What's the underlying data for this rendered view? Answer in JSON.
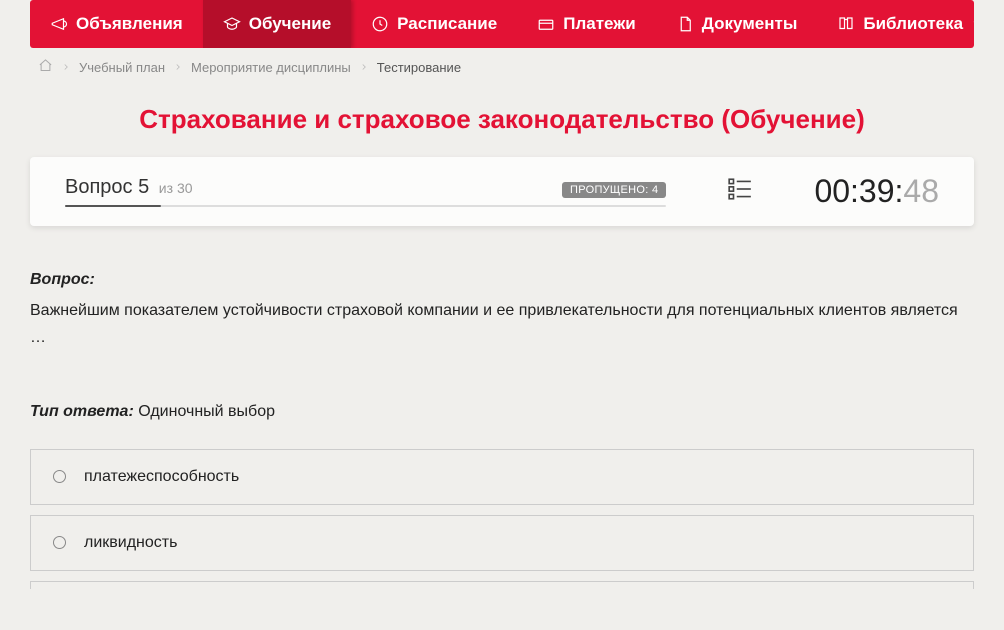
{
  "nav": [
    {
      "label": "Объявления",
      "icon": "megaphone"
    },
    {
      "label": "Обучение",
      "icon": "education",
      "active": true
    },
    {
      "label": "Расписание",
      "icon": "clock"
    },
    {
      "label": "Платежи",
      "icon": "payment"
    },
    {
      "label": "Документы",
      "icon": "document"
    },
    {
      "label": "Библиотека",
      "icon": "library",
      "hasChevron": true
    }
  ],
  "breadcrumb": {
    "items": [
      "Учебный план",
      "Мероприятие дисциплины",
      "Тестирование"
    ]
  },
  "title": "Страхование и страховое законодательство (Обучение)",
  "progress": {
    "question_label": "Вопрос",
    "current": "5",
    "of_label": "из",
    "total": "30",
    "skipped_label": "ПРОПУЩЕНО:",
    "skipped_count": "4",
    "timer_main": "00:39:",
    "timer_sec": "48"
  },
  "question": {
    "label": "Вопрос:",
    "text": "Важнейшим показателем устойчивости страховой компании и ее привлекательности для потенциальных клиентов является …",
    "answer_type_label": "Тип ответа:",
    "answer_type": "Одиночный выбор"
  },
  "options": [
    {
      "text": "платежеспособность"
    },
    {
      "text": "ликвидность"
    }
  ]
}
